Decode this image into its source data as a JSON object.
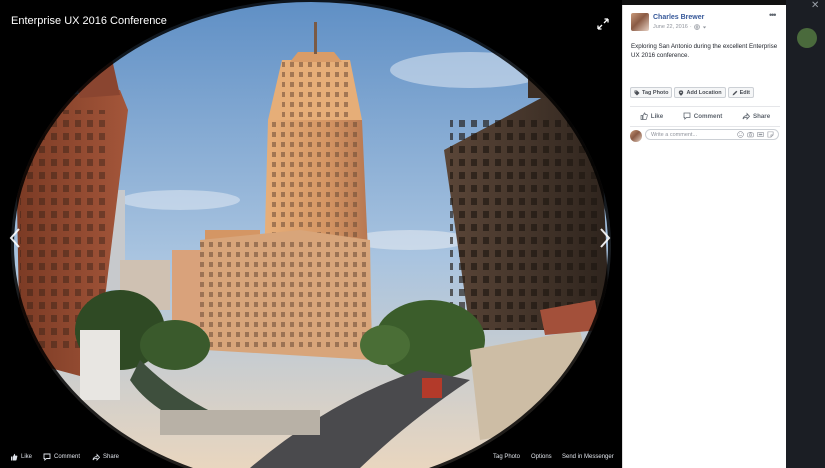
{
  "viewer": {
    "album_title": "Enterprise UX 2016 Conference",
    "bottom_bar": {
      "like": "Like",
      "comment": "Comment",
      "share": "Share",
      "tag_photo": "Tag Photo",
      "options": "Options",
      "send_in_messenger": "Send in Messenger"
    }
  },
  "post": {
    "author": "Charles Brewer",
    "date": "June 22, 2016",
    "audience_icon": "globe-icon",
    "caption": "Exploring San Antonio during the excellent Enterprise UX 2016 conference.",
    "pills": [
      {
        "label": "Tag Photo",
        "icon": "tag-icon"
      },
      {
        "label": "Add Location",
        "icon": "location-pin-icon"
      },
      {
        "label": "Edit",
        "icon": "pencil-icon"
      }
    ],
    "actions": {
      "like": "Like",
      "comment": "Comment",
      "share": "Share"
    },
    "comment_placeholder": "Write a comment..."
  },
  "colors": {
    "link_blue": "#365899",
    "panel_bg": "#ffffff",
    "viewer_bg": "#000000"
  }
}
